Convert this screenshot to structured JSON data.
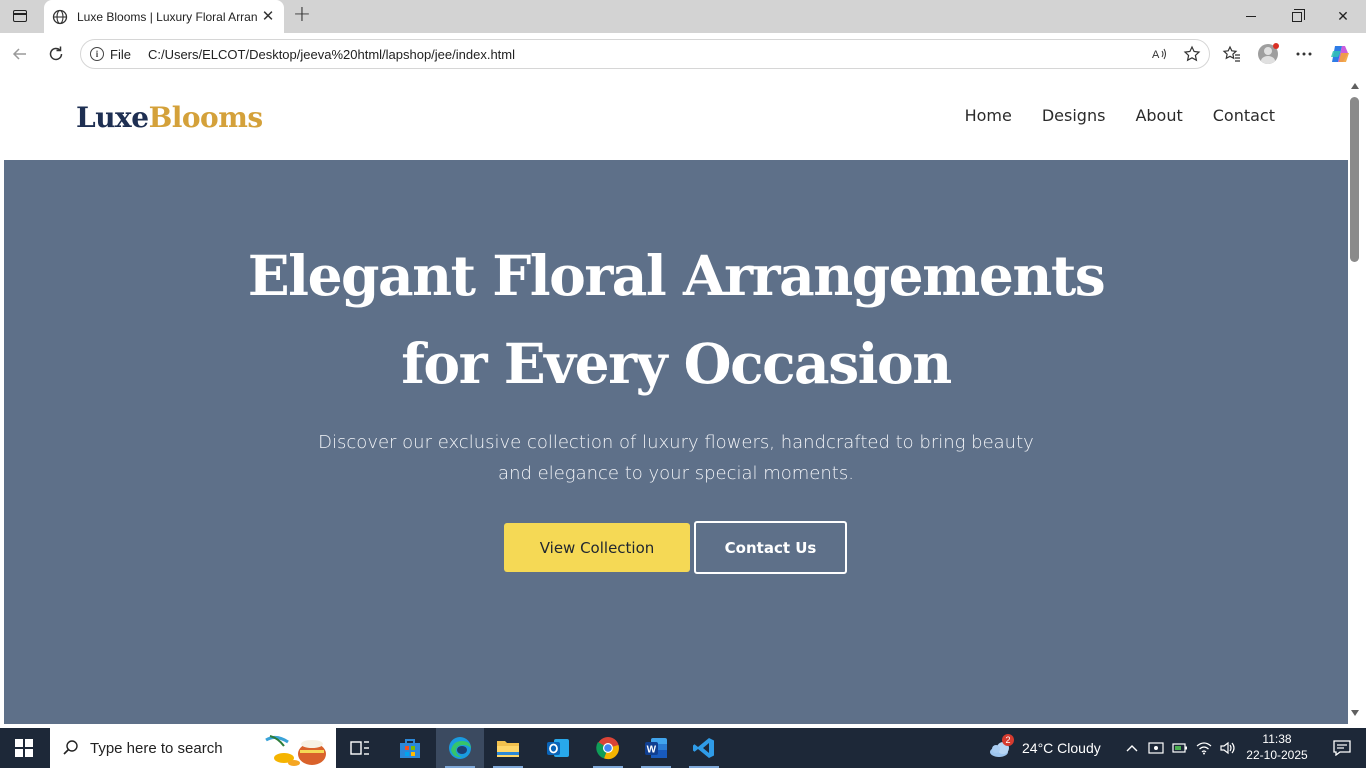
{
  "browser": {
    "tab_title": "Luxe Blooms | Luxury Floral Arrang",
    "url_scheme_label": "File",
    "url": "C:/Users/ELCOT/Desktop/jeeva%20html/lapshop/jee/index.html",
    "icons": [
      "sidebar-toggle-icon",
      "globe-icon",
      "close-icon",
      "plus-icon",
      "back-icon",
      "refresh-icon",
      "info-icon",
      "read-aloud-icon",
      "star-icon",
      "favorites-icon",
      "profile-icon",
      "more-icon",
      "copilot-icon"
    ]
  },
  "site": {
    "logo_part1": "Luxe",
    "logo_part2": "Blooms",
    "nav": [
      {
        "label": "Home"
      },
      {
        "label": "Designs"
      },
      {
        "label": "About"
      },
      {
        "label": "Contact"
      }
    ],
    "hero": {
      "title_line1": "Elegant Floral Arrangements",
      "title_line2": "for Every Occasion",
      "subtitle_line1": "Discover our exclusive collection of luxury flowers, handcrafted to bring beauty",
      "subtitle_line2": "and elegance to your special moments.",
      "primary_button": "View Collection",
      "secondary_button": "Contact Us"
    },
    "colors": {
      "hero_bg": "#5e7089",
      "logo_dark": "#1e2f52",
      "logo_gold": "#d4a13a",
      "primary_button_bg": "#f5d955"
    }
  },
  "taskbar": {
    "search_placeholder": "Type here to search",
    "weather": "24°C  Cloudy",
    "weather_badge": "2",
    "time": "11:38",
    "date": "22-10-2025",
    "apps": [
      "task-view-icon",
      "microsoft-store-icon",
      "edge-icon",
      "file-explorer-icon",
      "outlook-icon",
      "chrome-icon",
      "word-icon",
      "vscode-icon"
    ]
  }
}
